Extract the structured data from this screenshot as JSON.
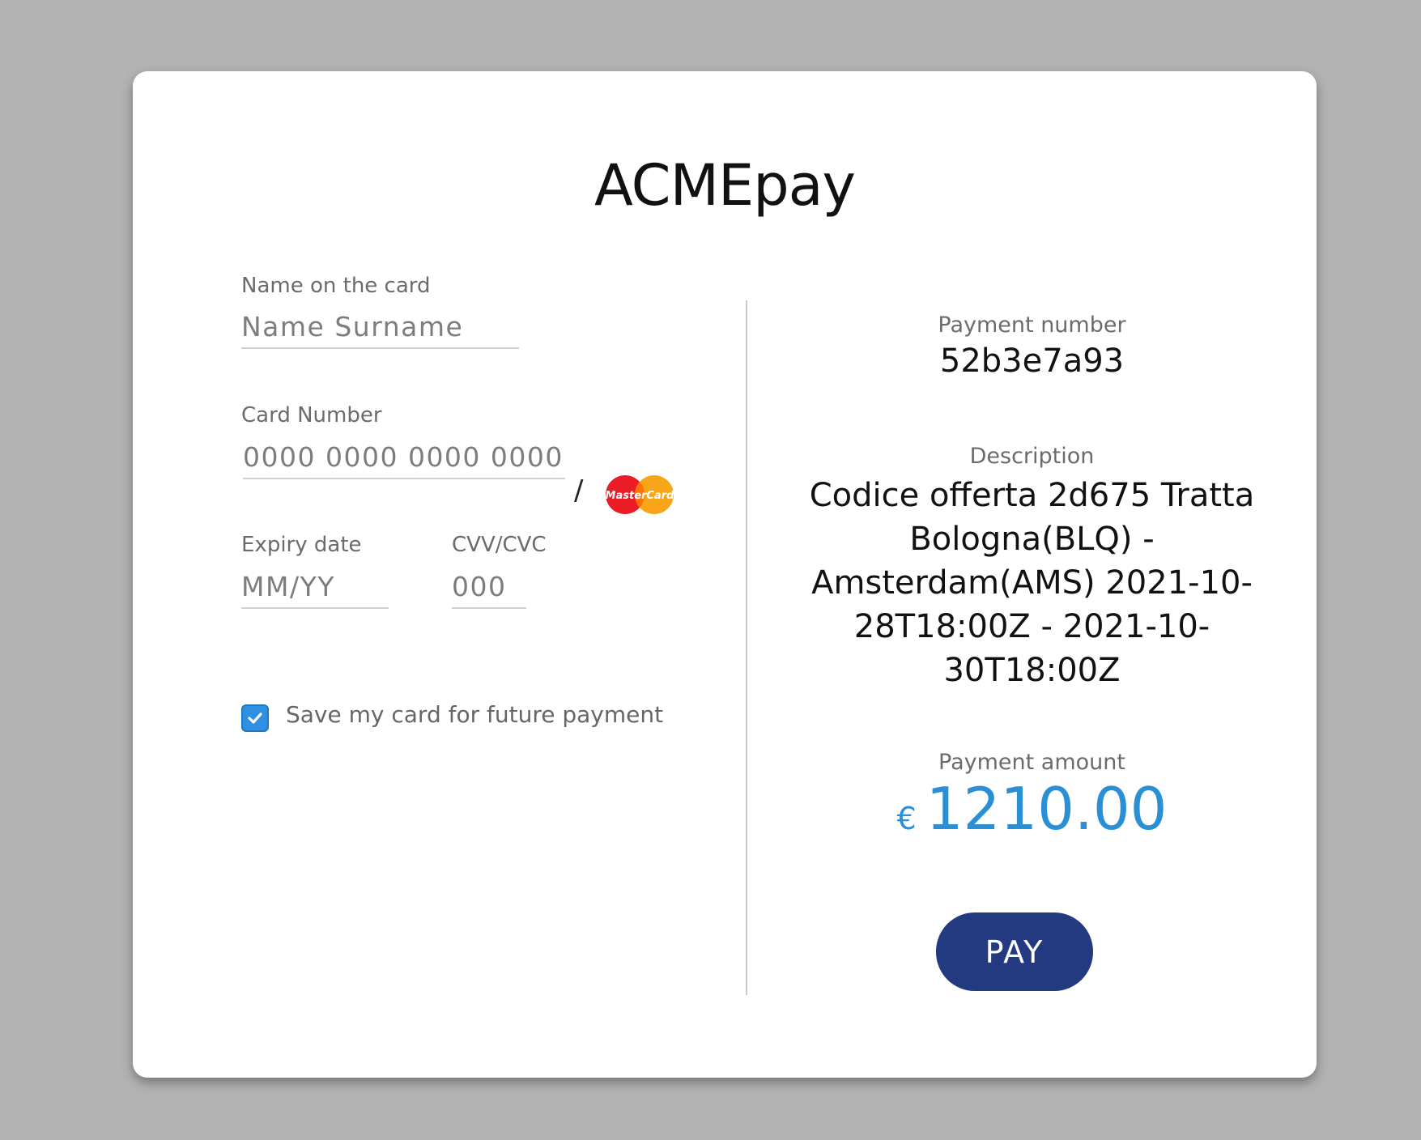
{
  "app": {
    "brand": "ACMEpay"
  },
  "form": {
    "name_label": "Name on the card",
    "name_placeholder": "Name Surname",
    "name_value": "",
    "card_label": "Card Number",
    "card_placeholder": "0000 0000 0000 0000",
    "card_value": "",
    "slash": "/",
    "card_brand": "MasterCard",
    "expiry_label": "Expiry date",
    "expiry_placeholder": "MM/YY",
    "expiry_value": "",
    "cvv_label": "CVV/CVC",
    "cvv_placeholder": "000",
    "cvv_value": "",
    "save_card_label": "Save my card for future payment",
    "save_card_checked": true
  },
  "summary": {
    "payment_number_label": "Payment number",
    "payment_number": "52b3e7a93",
    "description_label": "Description",
    "description": "Codice offerta 2d675 Tratta Bologna(BLQ) - Amsterdam(AMS) 2021-10-28T18:00Z - 2021-10-30T18:00Z",
    "amount_label": "Payment amount",
    "currency_symbol": "€",
    "amount": "1210.00",
    "pay_label": "PAY"
  },
  "colors": {
    "accent": "#2b8fd6",
    "pay_button": "#243a80",
    "checkbox": "#2f8fe0",
    "background": "#b3b3b3"
  },
  "icons": {
    "check": "check-icon",
    "card_brand": "mastercard-logo"
  }
}
